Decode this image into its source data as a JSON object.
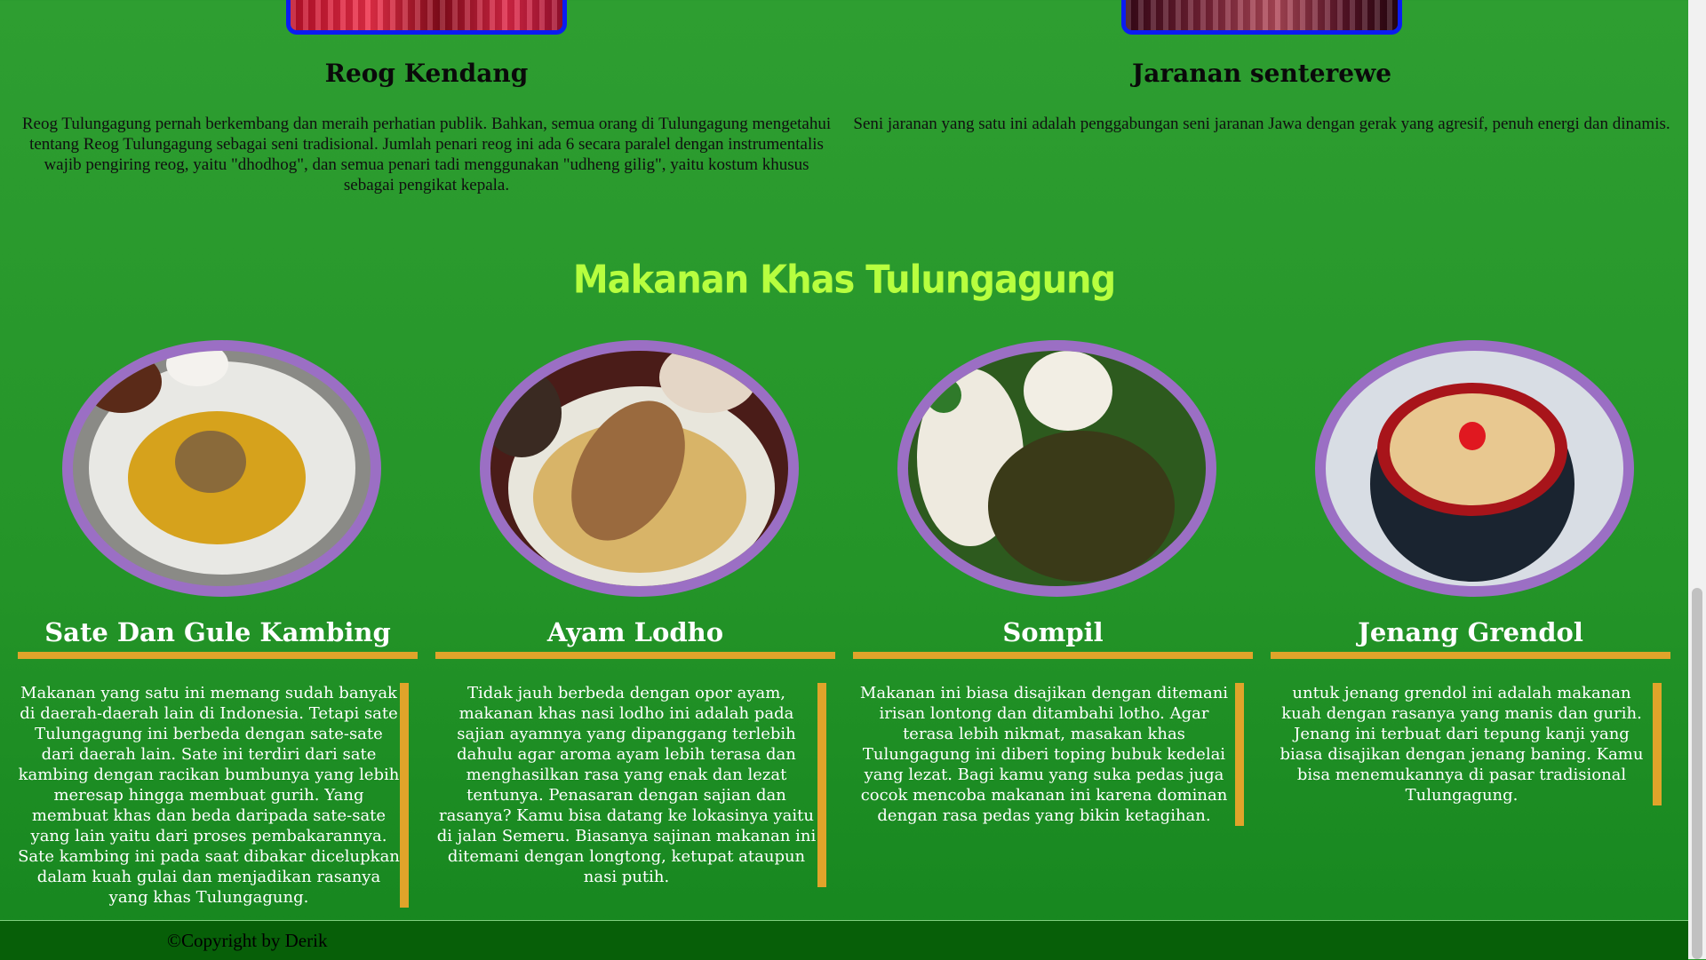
{
  "arts": [
    {
      "title": "Reog Kendang",
      "description": "Reog Tulungagung pernah berkembang dan meraih perhatian publik. Bahkan, semua orang di Tulungagung mengetahui tentang Reog Tulungagung sebagai seni tradisional. Jumlah penari reog ini ada 6 secara paralel dengan instrumentalis wajib pengiring reog, yaitu \"dhodhog\", dan semua penari tadi menggunakan \"udheng gilig\", yaitu kostum khusus sebagai pengikat kepala."
    },
    {
      "title": "Jaranan senterewe",
      "description": "Seni jaranan yang satu ini adalah penggabungan seni jaranan Jawa dengan gerak yang agresif, penuh energi dan dinamis."
    }
  ],
  "section_title": "Makanan Khas Tulungagung",
  "foods": [
    {
      "title": "Sate Dan Gule Kambing",
      "description": "Makanan yang satu ini memang sudah banyak di daerah-daerah lain di Indonesia. Tetapi sate Tulungagung ini berbeda dengan sate-sate dari daerah lain. Sate ini terdiri dari sate kambing dengan racikan bumbunya yang lebih meresap hingga membuat gurih. Yang membuat khas dan beda daripada sate-sate yang lain yaitu dari proses pembakarannya. Sate kambing ini pada saat dibakar dicelupkan dalam kuah gulai dan menjadikan rasanya yang khas Tulungagung."
    },
    {
      "title": "Ayam Lodho",
      "description": "Tidak jauh berbeda dengan opor ayam, makanan khas nasi lodho ini adalah pada sajian ayamnya yang dipanggang terlebih dahulu agar aroma ayam lebih terasa dan menghasilkan rasa yang enak dan lezat tentunya. Penasaran dengan sajian dan rasanya? Kamu bisa datang ke lokasinya yaitu di jalan Semeru. Biasanya sajinan makanan ini ditemani dengan longtong, ketupat ataupun nasi putih."
    },
    {
      "title": "Sompil",
      "description": "Makanan ini biasa disajikan dengan ditemani irisan lontong dan ditambahi lotho. Agar terasa lebih nikmat, masakan khas Tulungagung ini diberi toping bubuk kedelai yang lezat. Bagi kamu yang suka pedas juga cocok mencoba makanan ini karena dominan dengan rasa pedas yang bikin ketagihan."
    },
    {
      "title": "Jenang Grendol",
      "description": "untuk jenang grendol ini adalah makanan kuah dengan rasanya yang manis dan gurih. Jenang ini terbuat dari tepung kanji yang biasa disajikan dengan jenang baning. Kamu bisa menemukannya di pasar tradisional Tulungagung."
    }
  ],
  "footer": {
    "copyright": "©Copyright by Derik"
  },
  "colors": {
    "background": "#2e9e31",
    "section_title": "#b7ff3f",
    "image_border_art": "#0b1cf2",
    "image_border_food": "#9b6fc4",
    "accent_bar": "#e0a42a",
    "footer_bg": "#075f08"
  }
}
